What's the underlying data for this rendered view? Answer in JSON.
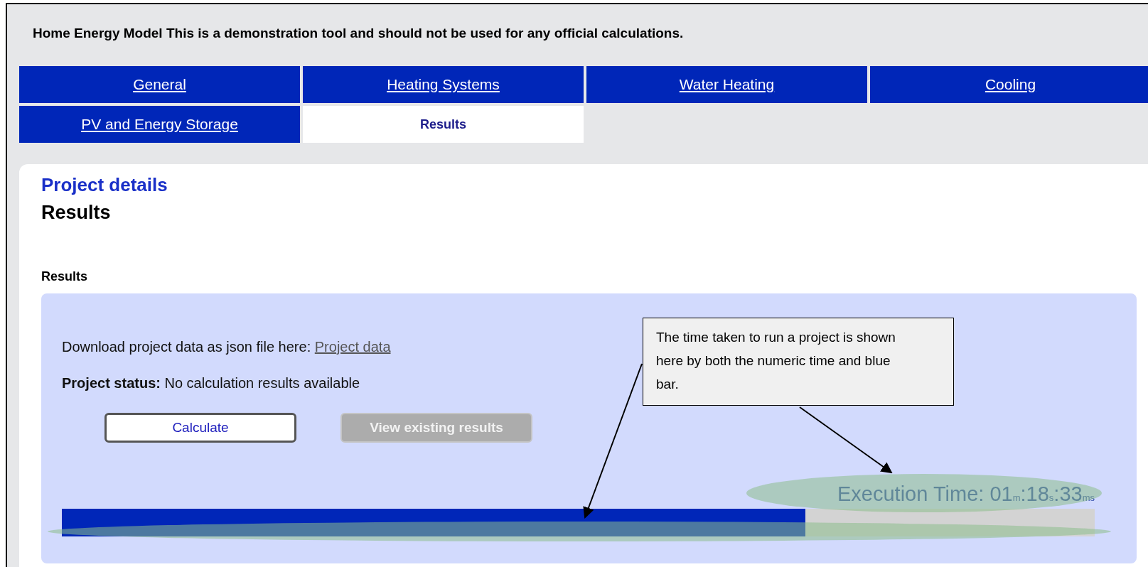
{
  "header": {
    "title": "Home Energy Model",
    "notice": "This is a demonstration tool and should not be used for any official calculations."
  },
  "tabs": [
    {
      "label": "General",
      "selected": false
    },
    {
      "label": "Heating Systems",
      "selected": false
    },
    {
      "label": "Water Heating",
      "selected": false
    },
    {
      "label": "Cooling",
      "selected": false
    },
    {
      "label": "PV and Energy Storage",
      "selected": false
    },
    {
      "label": "Results",
      "selected": true
    }
  ],
  "project": {
    "heading": "Project details",
    "title": "Results",
    "section": "Results",
    "download_text": "Download project data as json file here:",
    "download_link": "Project data",
    "status_label": "Project status:",
    "status_value": "No calculation results available",
    "buttons": [
      {
        "label": "Calculate",
        "disabled": false
      },
      {
        "label": "View existing results",
        "disabled": true
      }
    ],
    "execution_time": "Execution Time: 01$_{m}$:18$_{s}$:33$_{ms}$",
    "progress": {
      "level": 0.72
    }
  },
  "annotation": {
    "text": "The time taken to run a project is shown here by both the numeric time and blue bar."
  }
}
